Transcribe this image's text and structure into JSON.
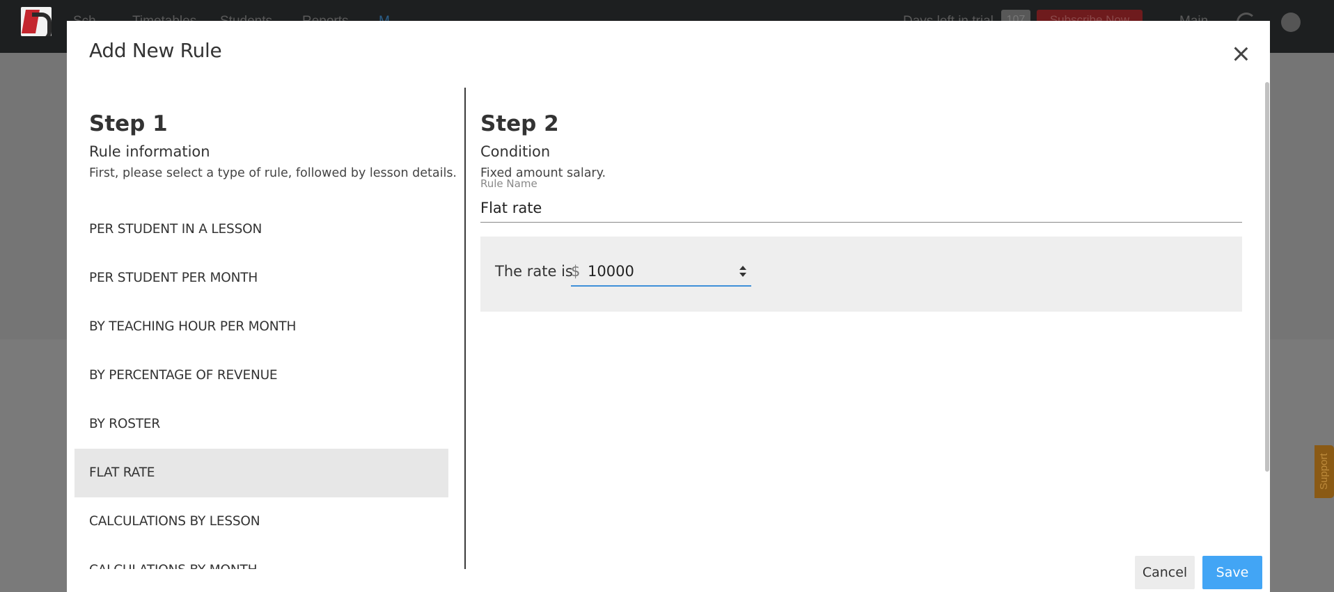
{
  "background": {
    "nav": [
      "Sch",
      "Timetables",
      "Students",
      "Reports",
      "M"
    ],
    "trial_text": "Days left in trial",
    "trial_count": "107",
    "subscribe_label": "Subscribe Now",
    "main_label": "Main",
    "support_label": "Support"
  },
  "modal": {
    "title": "Add New Rule",
    "close_icon": "close-icon",
    "step1": {
      "title": "Step 1",
      "subtitle": "Rule information",
      "description": "First, please select a type of rule, followed by lesson details.",
      "rule_types": [
        "PER STUDENT IN A LESSON",
        "PER STUDENT PER MONTH",
        "BY TEACHING HOUR PER MONTH",
        "BY PERCENTAGE OF REVENUE",
        "BY ROSTER",
        "FLAT RATE",
        "CALCULATIONS BY LESSON",
        "CALCULATIONS BY MONTH"
      ],
      "selected_index": 5
    },
    "step2": {
      "title": "Step 2",
      "subtitle": "Condition",
      "description": "Fixed amount salary.",
      "rule_name_label": "Rule Name",
      "rule_name_value": "Flat rate",
      "rate_label": "The rate is",
      "currency_symbol": "$",
      "rate_value": "10000"
    },
    "buttons": {
      "cancel": "Cancel",
      "save": "Save"
    }
  },
  "colors": {
    "accent": "#42a5f5",
    "selected_row": "#e7e7e7",
    "panel": "#eeeeee",
    "overlay": "#7b7b7b"
  }
}
